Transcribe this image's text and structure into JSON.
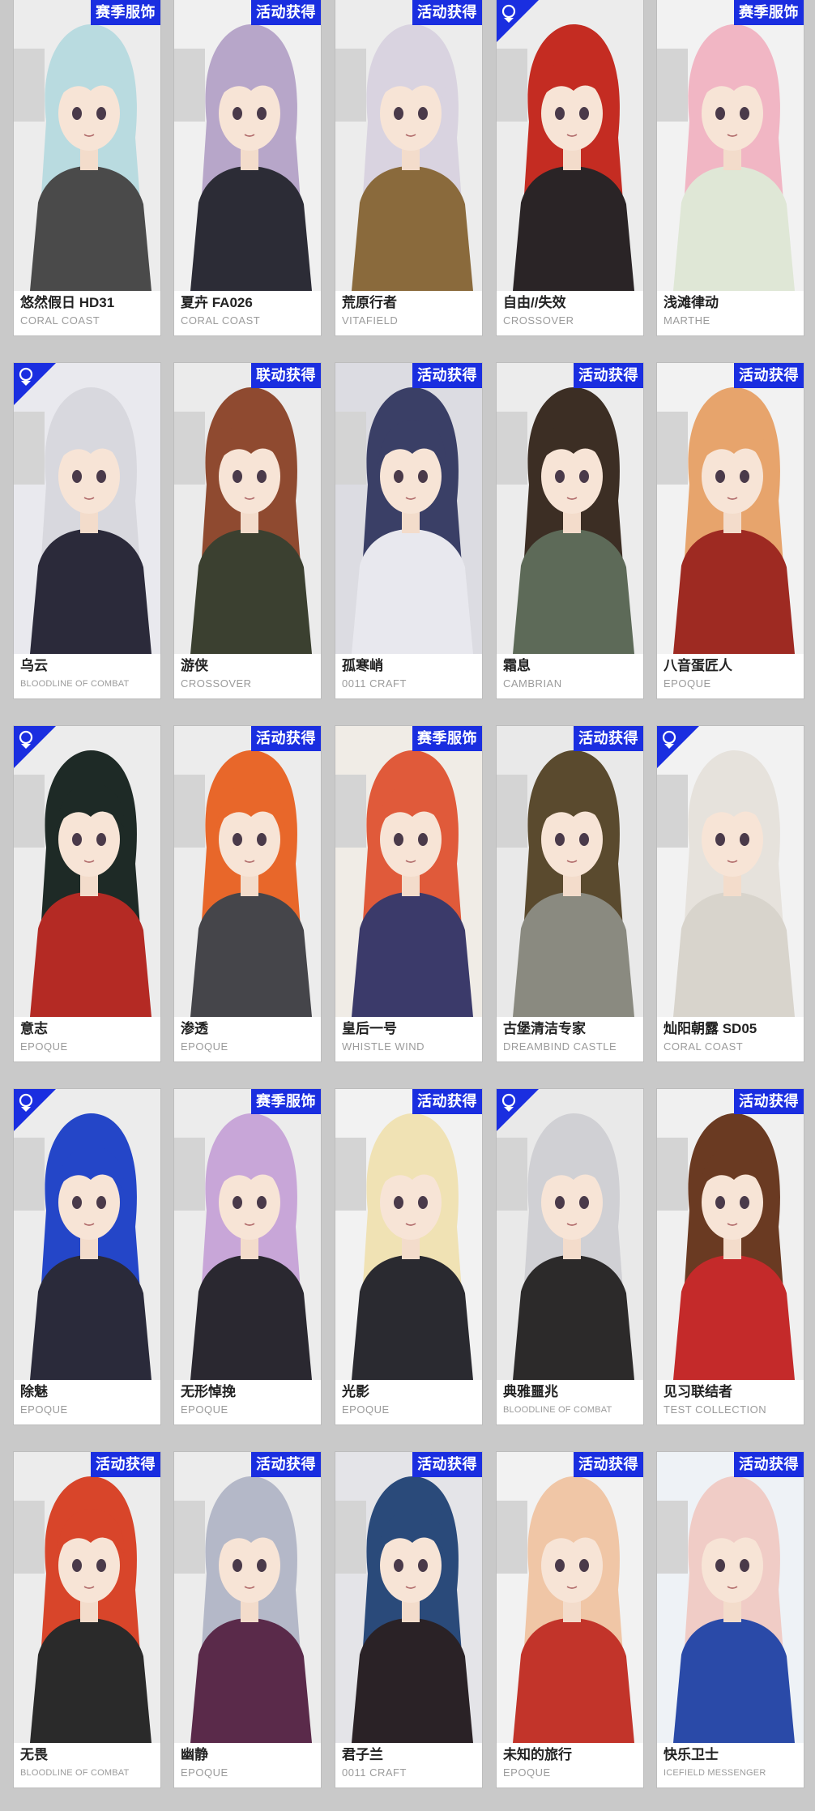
{
  "colors": {
    "page_background": "#c9c9c9",
    "badge_background": "#1a2ee0",
    "badge_text": "#ffffff",
    "name_text": "#222222",
    "collection_text": "#9b9b9b"
  },
  "cards": [
    {
      "name": "悠然假日 HD31",
      "collection": "CORAL COAST",
      "badge": "赛季服饰",
      "hair": "#b9dbe0",
      "outfit": "#4a4a4a",
      "bg": "#ececec"
    },
    {
      "name": "夏卉 FA026",
      "collection": "CORAL COAST",
      "badge": "活动获得",
      "hair": "#b7a6c9",
      "outfit": "#2c2c36",
      "bg": "#f0f0f0"
    },
    {
      "name": "荒原行者",
      "collection": "VITAFIELD",
      "badge": "活动获得",
      "hair": "#d9d3e0",
      "outfit": "#8a6a3c",
      "bg": "#ececec"
    },
    {
      "name": "自由//失效",
      "collection": "CROSSOVER",
      "badge": "",
      "corner": true,
      "hair": "#c42c22",
      "outfit": "#2a2426",
      "bg": "#ececec"
    },
    {
      "name": "浅滩律动",
      "collection": "MARTHE",
      "badge": "赛季服饰",
      "hair": "#f1b6c4",
      "outfit": "#dfe7d6",
      "bg": "#f2f2f2"
    },
    {
      "name": "乌云",
      "collection": "BLOODLINE OF COMBAT",
      "badge": "",
      "corner": true,
      "small": true,
      "hair": "#d8d8de",
      "outfit": "#2b2a3a",
      "bg": "#e9e9ee"
    },
    {
      "name": "游侠",
      "collection": "CROSSOVER",
      "badge": "联动获得",
      "hair": "#8f4a30",
      "outfit": "#3b4030",
      "bg": "#ebebeb"
    },
    {
      "name": "孤寒峭",
      "collection": "0011 CRAFT",
      "badge": "活动获得",
      "hair": "#3a3f66",
      "outfit": "#e8e8ee",
      "bg": "#dcdce2"
    },
    {
      "name": "霜息",
      "collection": "CAMBRIAN",
      "badge": "活动获得",
      "hair": "#3c2e24",
      "outfit": "#5d6a58",
      "bg": "#ececec"
    },
    {
      "name": "八音蛋匠人",
      "collection": "EPOQUE",
      "badge": "活动获得",
      "hair": "#e7a46c",
      "outfit": "#9e2a22",
      "bg": "#f2f2f2"
    },
    {
      "name": "意志",
      "collection": "EPOQUE",
      "badge": "",
      "corner": true,
      "hair": "#1e2a26",
      "outfit": "#b42a24",
      "bg": "#ececec"
    },
    {
      "name": "渗透",
      "collection": "EPOQUE",
      "badge": "活动获得",
      "hair": "#e8672a",
      "outfit": "#45454a",
      "bg": "#ececec"
    },
    {
      "name": "皇后一号",
      "collection": "WHISTLE WIND",
      "badge": "赛季服饰",
      "hair": "#e05a3a",
      "outfit": "#3b3a6a",
      "bg": "#f0ece6"
    },
    {
      "name": "古堡清洁专家",
      "collection": "DREAMBIND CASTLE",
      "badge": "活动获得",
      "hair": "#5a4a2e",
      "outfit": "#8a8a80",
      "bg": "#e9e9e9"
    },
    {
      "name": "灿阳朝露 SD05",
      "collection": "CORAL COAST",
      "badge": "",
      "corner": true,
      "hair": "#e6e2dc",
      "outfit": "#d8d4cc",
      "bg": "#f2f2f2"
    },
    {
      "name": "除魅",
      "collection": "EPOQUE",
      "badge": "",
      "corner": true,
      "hair": "#2446c8",
      "outfit": "#2a2a3a",
      "bg": "#ececec"
    },
    {
      "name": "无形悼挽",
      "collection": "EPOQUE",
      "badge": "赛季服饰",
      "hair": "#c8a6d8",
      "outfit": "#2a2830",
      "bg": "#ececec"
    },
    {
      "name": "光影",
      "collection": "EPOQUE",
      "badge": "活动获得",
      "hair": "#f0e2b4",
      "outfit": "#2a2a30",
      "bg": "#f2f2f2"
    },
    {
      "name": "典雅噩兆",
      "collection": "BLOODLINE OF COMBAT",
      "badge": "",
      "corner": true,
      "small": true,
      "hair": "#d0d0d4",
      "outfit": "#2c2a2a",
      "bg": "#e9e9e9"
    },
    {
      "name": "见习联结者",
      "collection": "TEST COLLECTION",
      "badge": "活动获得",
      "hair": "#6a3a22",
      "outfit": "#c42a2a",
      "bg": "#f0f0f0"
    },
    {
      "name": "无畏",
      "collection": "BLOODLINE OF COMBAT",
      "badge": "活动获得",
      "small": true,
      "hair": "#d8452a",
      "outfit": "#2a2a2a",
      "bg": "#ececec"
    },
    {
      "name": "幽静",
      "collection": "EPOQUE",
      "badge": "活动获得",
      "hair": "#b4b8c8",
      "outfit": "#5a2a4a",
      "bg": "#ececec"
    },
    {
      "name": "君子兰",
      "collection": "0011 CRAFT",
      "badge": "活动获得",
      "hair": "#2a4a7a",
      "outfit": "#2a2226",
      "bg": "#e4e4e8"
    },
    {
      "name": "未知的旅行",
      "collection": "EPOQUE",
      "badge": "活动获得",
      "hair": "#f0c6a6",
      "outfit": "#c2342a",
      "bg": "#f2f2f2"
    },
    {
      "name": "快乐卫士",
      "collection": "ICEFIELD MESSENGER",
      "badge": "活动获得",
      "small": true,
      "hair": "#f0ccc6",
      "outfit": "#2a4aa8",
      "bg": "#eef2f6"
    }
  ]
}
